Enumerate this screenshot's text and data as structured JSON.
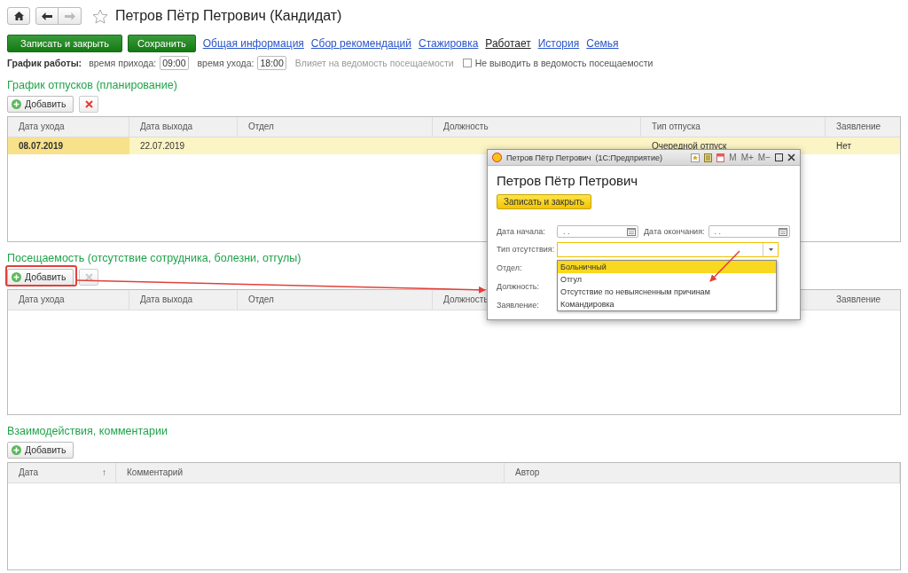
{
  "window": {
    "title": "Петров Пётр Петрович (Кандидат)"
  },
  "commands": [
    {
      "label": "Записать и закрыть"
    },
    {
      "label": "Сохранить"
    }
  ],
  "tabs": [
    {
      "label": "Общая информация",
      "selected": false
    },
    {
      "label": "Сбор рекомендаций",
      "selected": false
    },
    {
      "label": "Стажировка",
      "selected": false
    },
    {
      "label": "Работает",
      "selected": true
    },
    {
      "label": "История",
      "selected": false
    },
    {
      "label": "Семья",
      "selected": false
    }
  ],
  "schedule": {
    "label": "График работы:",
    "arrival_label": "время прихода:",
    "arrival": "09:00",
    "leave_label": "время ухода:",
    "leave": "18:00",
    "note": "Влияет на ведомость посещаемости",
    "exclude": {
      "label": "Не выводить в ведомость посещаемости",
      "checked": false
    }
  },
  "sections": [
    {
      "title": "График отпусков (планирование)",
      "add_button": "Добавить",
      "delete_disabled": false,
      "columns": [
        {
          "label": "Дата ухода"
        },
        {
          "label": "Дата выхода"
        },
        {
          "label": "Отдел"
        },
        {
          "label": "Должность"
        },
        {
          "label": "Тип отпуска"
        },
        {
          "label": "Заявление"
        }
      ],
      "rows": [
        {
          "selected": true,
          "cells": [
            "08.07.2019",
            "22.07.2019",
            "",
            "",
            "Очередной отпуск",
            "Нет"
          ]
        }
      ]
    },
    {
      "title": "Посещаемость (отсутствие сотрудника, болезни, отгулы)",
      "add_button": "Добавить",
      "delete_disabled": true,
      "highlighted": true,
      "columns": [
        {
          "label": "Дата ухода"
        },
        {
          "label": "Дата выхода"
        },
        {
          "label": "Отдел"
        },
        {
          "label": "Должность"
        },
        {
          "label": "Заявление"
        }
      ]
    },
    {
      "title": "Взаимодействия, комментарии",
      "add_button": "Добавить",
      "columns": [
        {
          "label": "Дата",
          "sort": "↑"
        },
        {
          "label": "Комментарий"
        },
        {
          "label": "Автор"
        }
      ]
    }
  ],
  "dialog": {
    "title": "Петров Пётр Петрович  (1С:Предприятие)",
    "toolbar": [
      "M",
      "M+",
      "M−"
    ],
    "heading": "Петров Пётр Петрович",
    "save_button": "Записать и закрыть",
    "start_label": "Дата начала:",
    "start_value": ". .",
    "end_label": "Дата окончания:",
    "end_value": ". .",
    "type_label": "Тип отсутствия:",
    "fields": [
      {
        "label": "Отдел:"
      },
      {
        "label": "Должность:"
      },
      {
        "label": "Заявление:"
      }
    ],
    "options": [
      {
        "label": "Больничный",
        "selected": true
      },
      {
        "label": "Отгул",
        "selected": false
      },
      {
        "label": "Отсутствие по невыясненным причинам",
        "selected": false
      },
      {
        "label": "Командировка",
        "selected": false
      }
    ]
  }
}
